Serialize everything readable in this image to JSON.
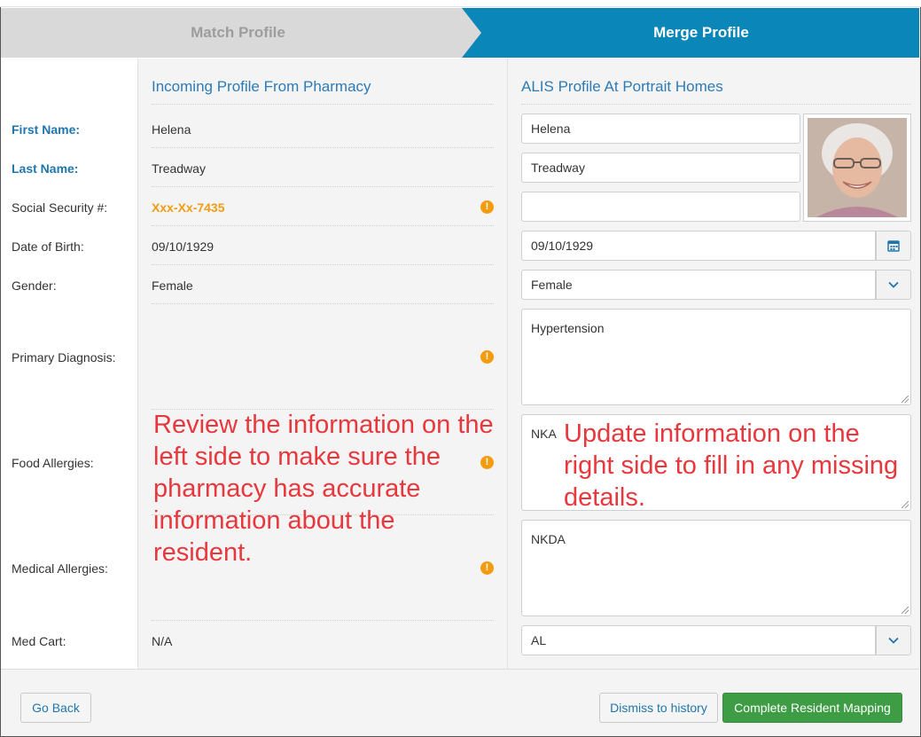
{
  "steps": {
    "match": "Match Profile",
    "merge": "Merge Profile"
  },
  "labels": {
    "first_name": "First Name:",
    "last_name": "Last Name:",
    "ssn": "Social Security #:",
    "dob": "Date of Birth:",
    "gender": "Gender:",
    "primary_diagnosis": "Primary Diagnosis:",
    "food_allergies": "Food Allergies:",
    "medical_allergies": "Medical Allergies:",
    "med_cart": "Med Cart:"
  },
  "incoming": {
    "heading": "Incoming Profile From Pharmacy",
    "first_name": "Helena",
    "last_name": "Treadway",
    "ssn": "Xxx-Xx-7435",
    "dob": "09/10/1929",
    "gender": "Female",
    "med_cart": "N/A"
  },
  "alis": {
    "heading": "ALIS Profile At Portrait Homes",
    "first_name": "Helena",
    "last_name": "Treadway",
    "ssn": "",
    "dob": "09/10/1929",
    "gender": "Female",
    "primary_diagnosis": "Hypertension",
    "food_allergies": "NKA",
    "medical_allergies": "NKDA",
    "med_cart": "AL"
  },
  "annotations": {
    "left": "Review the information on the left side to make sure the pharmacy has accurate information about the resident.",
    "right": "Update information on the right side to fill in any missing details."
  },
  "footer": {
    "go_back": "Go Back",
    "dismiss": "Dismiss to history",
    "complete": "Complete Resident Mapping"
  },
  "icons": {
    "warning": "exclamation-circle-icon",
    "calendar": "calendar-icon",
    "dropdown": "chevron-down-icon"
  },
  "colors": {
    "accent": "#0a86b9",
    "warning": "#f39c12",
    "annotation": "#e8373d",
    "success": "#3e9c45"
  }
}
